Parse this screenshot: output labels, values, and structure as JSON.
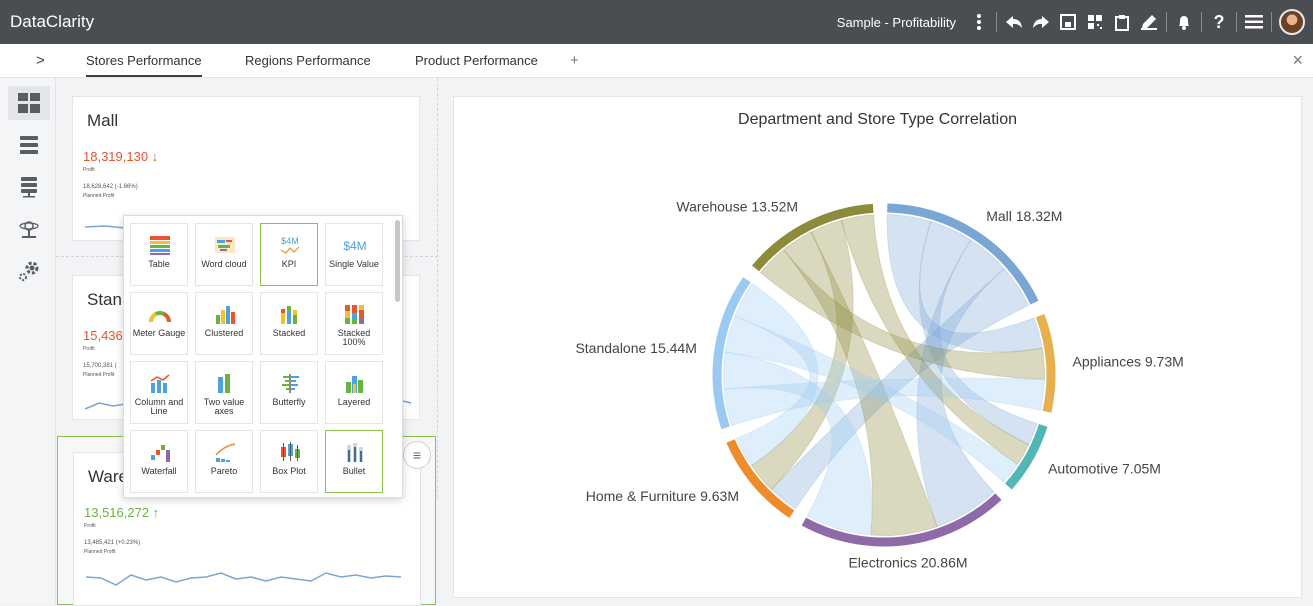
{
  "app": {
    "title": "DataClarity",
    "project": "Sample - Profitability"
  },
  "topbar_icons": [
    "more-vertical-icon",
    "undo-icon",
    "redo-icon",
    "save-icon",
    "qr-icon",
    "clipboard-icon",
    "edit-icon",
    "bell-icon",
    "help-icon",
    "menu-icon",
    "avatar"
  ],
  "toolbar": {
    "expand": ">",
    "add_tab": "+",
    "close": "×",
    "help": "?"
  },
  "tabs": [
    {
      "label": "Stores Performance",
      "active": true
    },
    {
      "label": "Regions Performance",
      "active": false
    },
    {
      "label": "Product Performance",
      "active": false
    }
  ],
  "sidebar": [
    "dashboard-icon",
    "data-icon",
    "database-icon",
    "network-icon",
    "settings-icon"
  ],
  "cards": [
    {
      "title": "Mall",
      "value": "18,319,130 ↓",
      "value_caption": "Profit",
      "planned": "18,628,642 (-1.66%)",
      "planned_caption": "Planned Profit",
      "color": "#e8562e"
    },
    {
      "title": "Stan",
      "value": "15,436,8",
      "value_caption": "Profit",
      "planned": "15,700,381 (",
      "planned_caption": "Planned Profit",
      "color": "#e8562e"
    },
    {
      "title": "Ware",
      "value": "13,516,272 ↑",
      "value_caption": "Profit",
      "planned": "13,485,421 (+0.23%)",
      "planned_caption": "Planned Profit",
      "color": "#6ab23e"
    }
  ],
  "picker": {
    "items": [
      {
        "label": "Table",
        "icon": "table-icon",
        "selected": false
      },
      {
        "label": "Word cloud",
        "icon": "word-cloud-icon",
        "selected": false
      },
      {
        "label": "KPI",
        "icon": "kpi-icon",
        "selected": true
      },
      {
        "label": "Single Value",
        "icon": "single-value-icon",
        "selected": false
      },
      {
        "label": "Meter Gauge",
        "icon": "meter-gauge-icon",
        "selected": false
      },
      {
        "label": "Clustered",
        "icon": "clustered-bar-icon",
        "selected": false
      },
      {
        "label": "Stacked",
        "icon": "stacked-bar-icon",
        "selected": false
      },
      {
        "label": "Stacked 100%",
        "icon": "stacked-100-icon",
        "selected": false
      },
      {
        "label": "Column and Line",
        "icon": "column-line-icon",
        "selected": false
      },
      {
        "label": "Two value axes",
        "icon": "two-axes-icon",
        "selected": false
      },
      {
        "label": "Butterfly",
        "icon": "butterfly-icon",
        "selected": false
      },
      {
        "label": "Layered",
        "icon": "layered-icon",
        "selected": false
      },
      {
        "label": "Waterfall",
        "icon": "waterfall-icon",
        "selected": false
      },
      {
        "label": "Pareto",
        "icon": "pareto-icon",
        "selected": false
      },
      {
        "label": "Box Plot",
        "icon": "box-plot-icon",
        "selected": false
      },
      {
        "label": "Bullet",
        "icon": "bullet-icon",
        "selected": true
      }
    ],
    "kpi_icon_text": "$4M",
    "single_value_icon_text": "$4M"
  },
  "chart_data": {
    "type": "chord",
    "title": "Department and Store Type Correlation",
    "nodes": [
      {
        "label": "Mall 18.32M",
        "value": 18.32,
        "color": "#7aa6d6"
      },
      {
        "label": "Appliances 9.73M",
        "value": 9.73,
        "color": "#e6b04e"
      },
      {
        "label": "Automotive 7.05M",
        "value": 7.05,
        "color": "#52b6b6"
      },
      {
        "label": "Electronics 20.86M",
        "value": 20.86,
        "color": "#8e6aa8"
      },
      {
        "label": "Home & Furniture 9.63M",
        "value": 9.63,
        "color": "#ee8c2c"
      },
      {
        "label": "Standalone 15.44M",
        "value": 15.44,
        "color": "#9ac9f2"
      },
      {
        "label": "Warehouse 13.52M",
        "value": 13.52,
        "color": "#8d8a3c"
      }
    ]
  }
}
